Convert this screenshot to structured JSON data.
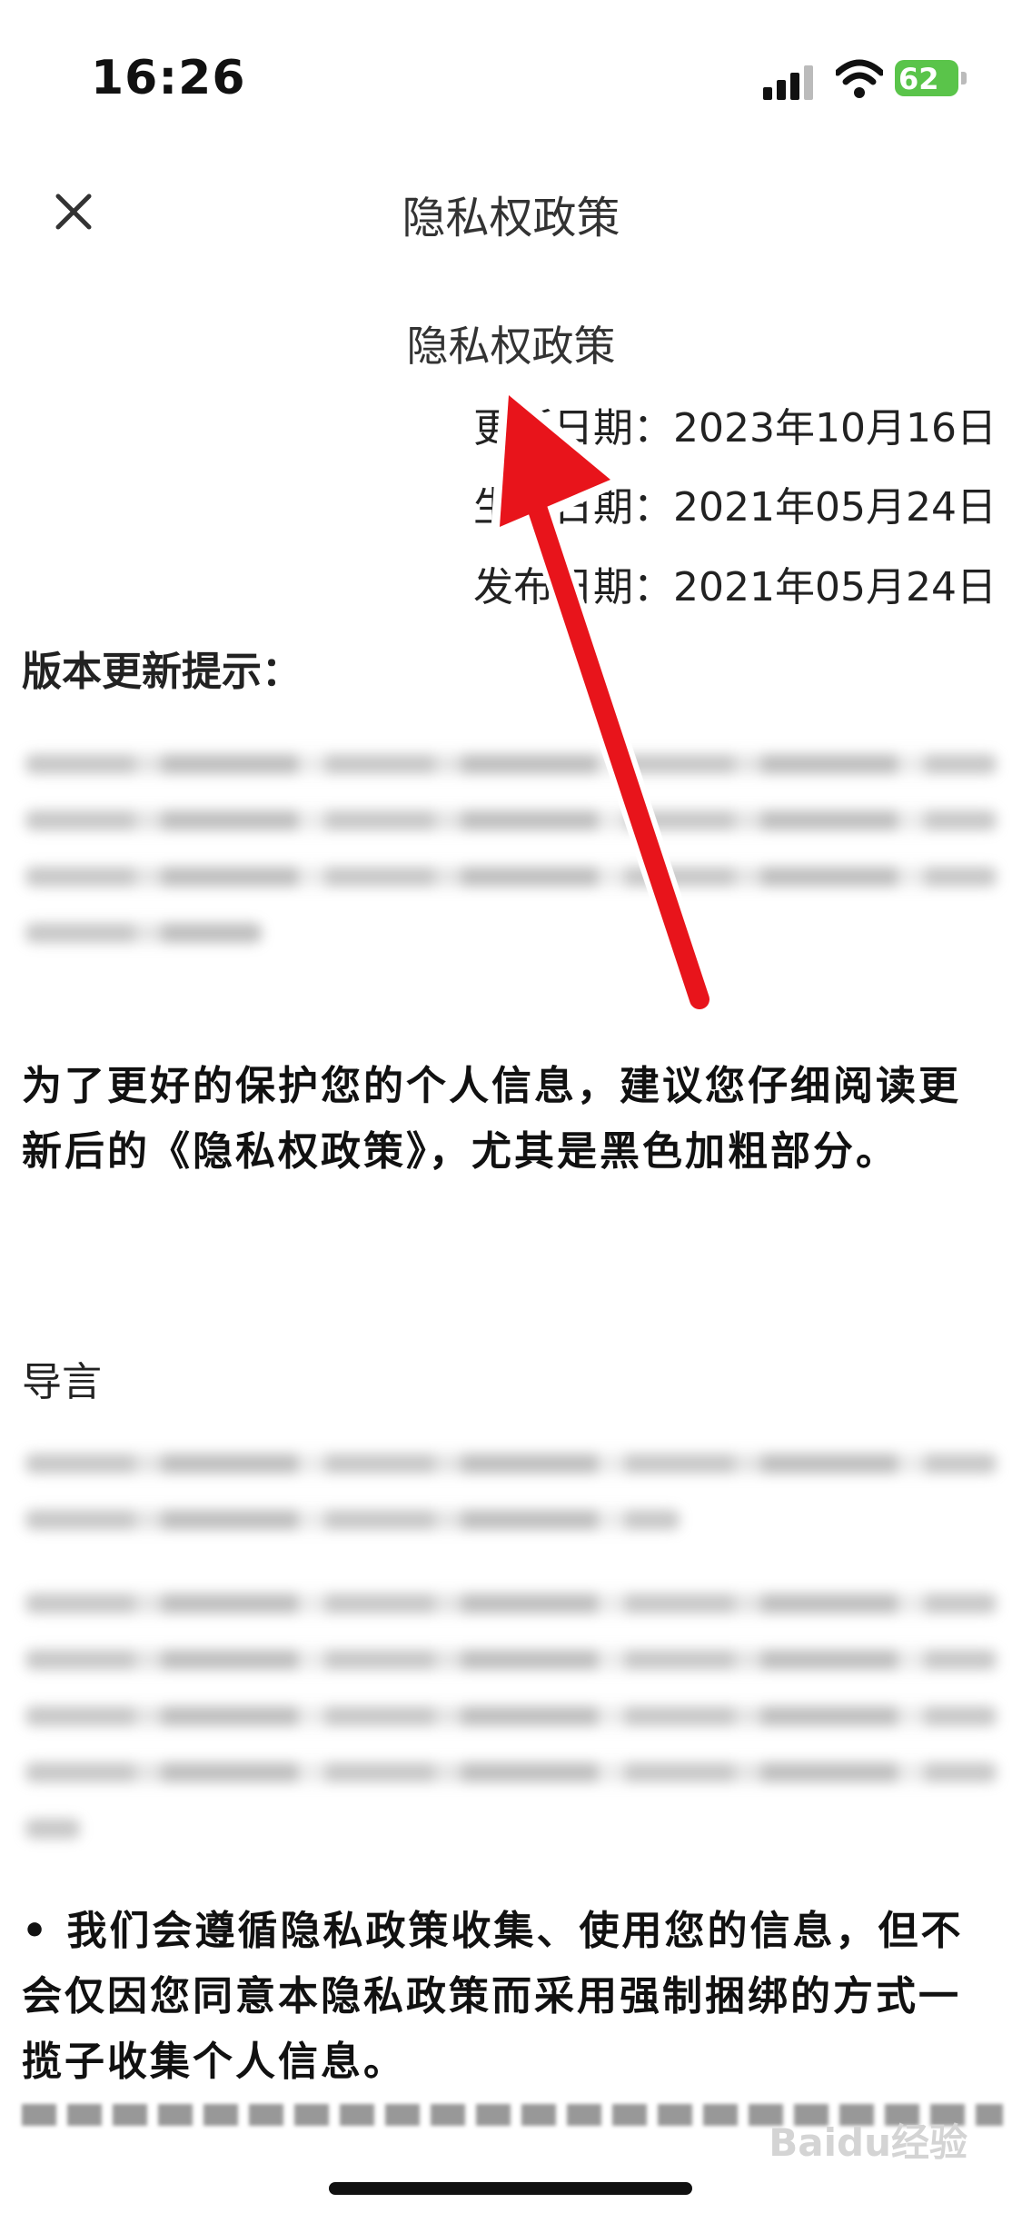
{
  "status_bar": {
    "time": "16:26",
    "battery": "62"
  },
  "nav": {
    "title": "隐私权政策",
    "close_icon": "close-icon"
  },
  "document": {
    "title": "隐私权政策",
    "meta": [
      "更新日期：2023年10月16日",
      "生效日期：2021年05月24日",
      "发布日期：2021年05月24日"
    ],
    "version_heading": "版本更新提示：",
    "advice": "为了更好的保护您的个人信息，建议您仔细阅读更新后的《隐私权政策》，尤其是黑色加粗部分。",
    "intro_heading": "导言",
    "bullet": "• 我们会遵循隐私政策收集、使用您的信息，但不会仅因您同意本隐私政策而采用强制捆绑的方式一揽子收集个人信息。"
  },
  "watermark": "Baidu经验",
  "colors": {
    "arrow": "#e8141b",
    "battery": "#5ac44a"
  }
}
